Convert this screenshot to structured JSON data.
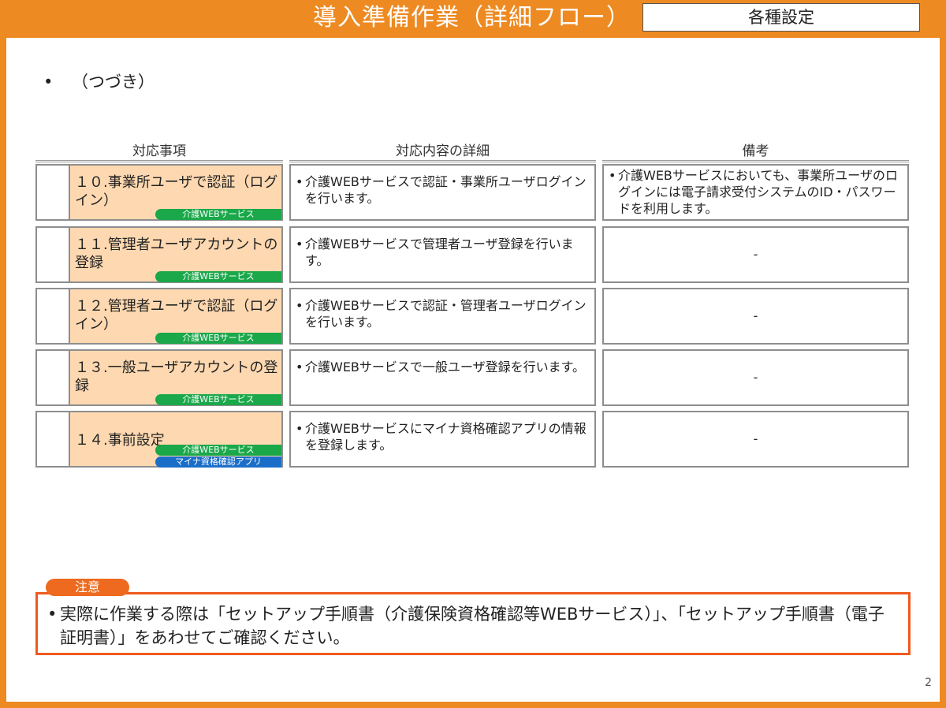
{
  "header": {
    "title": "導入準備作業（詳細フロー）",
    "section": "各種設定"
  },
  "intro_bullet": "（つづき）",
  "table": {
    "columns": [
      "対応事項",
      "対応内容の詳細",
      "備考"
    ],
    "rows": [
      {
        "item": "１０.事業所ユーザで認証（ログイン）",
        "badges": [
          "介護WEBサービス"
        ],
        "detail": "介護WEBサービスで認証・事業所ユーザログインを行います。",
        "note": "介護WEBサービスにおいても、事業所ユーザのログインには電子請求受付システムのID・パスワードを利用します。"
      },
      {
        "item": "１１.管理者ユーザアカウントの登録",
        "badges": [
          "介護WEBサービス"
        ],
        "detail": "介護WEBサービスで管理者ユーザ登録を行います。",
        "note": "-"
      },
      {
        "item": "１２.管理者ユーザで認証（ログイン）",
        "badges": [
          "介護WEBサービス"
        ],
        "detail": "介護WEBサービスで認証・管理者ユーザログインを行います。",
        "note": "-"
      },
      {
        "item": "１３.一般ユーザアカウントの登録",
        "badges": [
          "介護WEBサービス"
        ],
        "detail": "介護WEBサービスで一般ユーザ登録を行います。",
        "note": "-"
      },
      {
        "item": "１４.事前設定",
        "badges": [
          "介護WEBサービス",
          "マイナ資格確認アプリ"
        ],
        "detail": "介護WEBサービスにマイナ資格確認アプリの情報を登録します。",
        "note": "-"
      }
    ]
  },
  "notice": {
    "label": "注意",
    "text": "実際に作業する際は「セットアップ手順書（介護保険資格確認等WEBサービス）」、「セットアップ手順書（電子証明書）」をあわせてご確認ください。"
  },
  "page_number": "2",
  "colors": {
    "frame": "#ee8a22",
    "item_fill": "#fdd8b0",
    "badge_web": "#1aa84a",
    "badge_app": "#1a6ec8",
    "notice_border": "#ee5a1e"
  }
}
